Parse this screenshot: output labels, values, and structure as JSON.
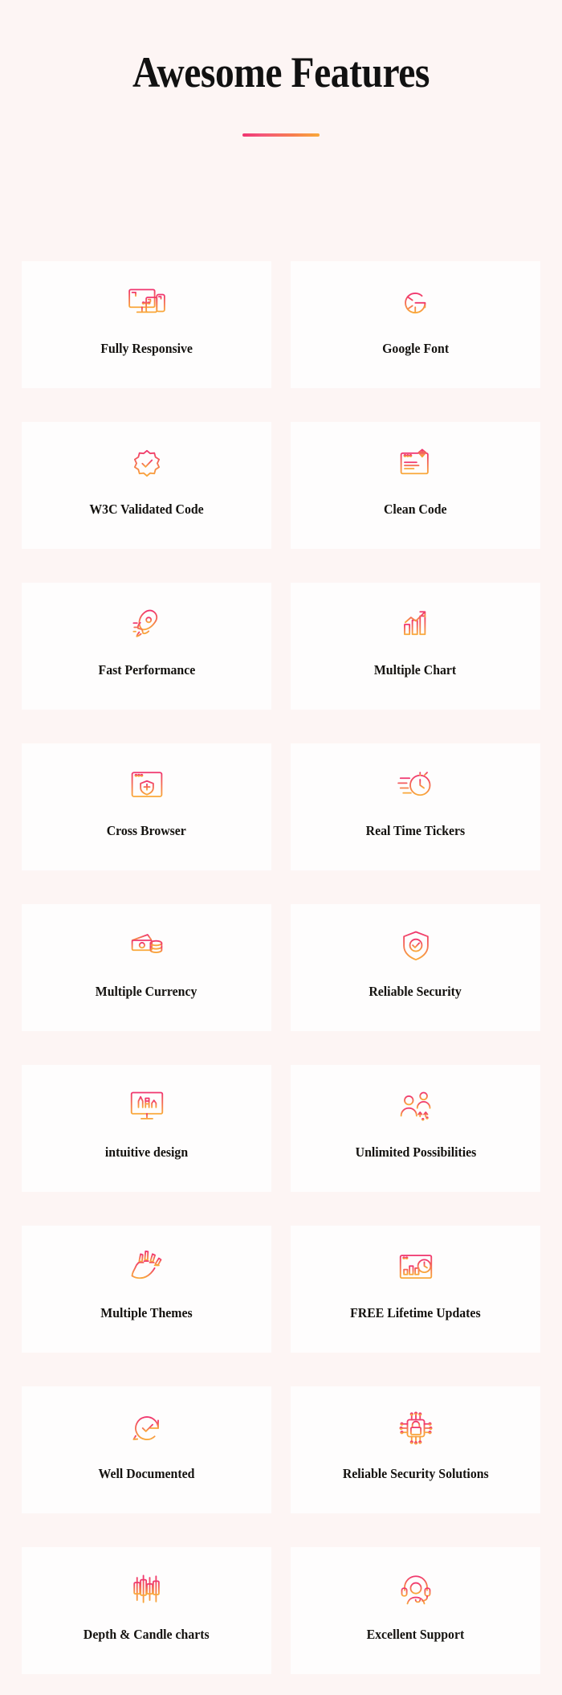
{
  "header": {
    "title": "Awesome Features",
    "divider_gradient_from": "#f0356f",
    "divider_gradient_to": "#f9a93a"
  },
  "theme": {
    "page_background": "#fdf5f4",
    "card_background": "#fefdfd",
    "icon_gradient_from": "#f0356f",
    "icon_gradient_to": "#f9a93a",
    "title_color": "#111111",
    "label_color": "#14120f"
  },
  "features": [
    {
      "label": "Fully Responsive",
      "icon": "responsive-devices-icon"
    },
    {
      "label": "Google Font",
      "icon": "google-g-icon"
    },
    {
      "label": "W3C Validated Code",
      "icon": "badge-check-icon"
    },
    {
      "label": "Clean Code",
      "icon": "code-window-diamond-icon"
    },
    {
      "label": "Fast Performance",
      "icon": "rocket-icon"
    },
    {
      "label": "Multiple Chart",
      "icon": "bar-chart-arrow-icon"
    },
    {
      "label": "Cross Browser",
      "icon": "browser-shield-icon"
    },
    {
      "label": "Real Time Tickers",
      "icon": "speed-clock-icon"
    },
    {
      "label": "Multiple Currency",
      "icon": "money-coins-icon"
    },
    {
      "label": "Reliable Security",
      "icon": "shield-check-icon"
    },
    {
      "label": "intuitive design",
      "icon": "design-monitor-icon"
    },
    {
      "label": "Unlimited Possibilities",
      "icon": "people-ideas-icon"
    },
    {
      "label": "Multiple Themes",
      "icon": "paint-brushes-icon"
    },
    {
      "label": "FREE Lifetime Updates",
      "icon": "dashboard-clock-icon"
    },
    {
      "label": "Well Documented",
      "icon": "refresh-check-icon"
    },
    {
      "label": "Reliable Security Solutions",
      "icon": "chip-lock-icon"
    },
    {
      "label": "Depth & Candle charts",
      "icon": "candlestick-chart-icon"
    },
    {
      "label": "Excellent Support",
      "icon": "headset-agent-icon"
    }
  ]
}
